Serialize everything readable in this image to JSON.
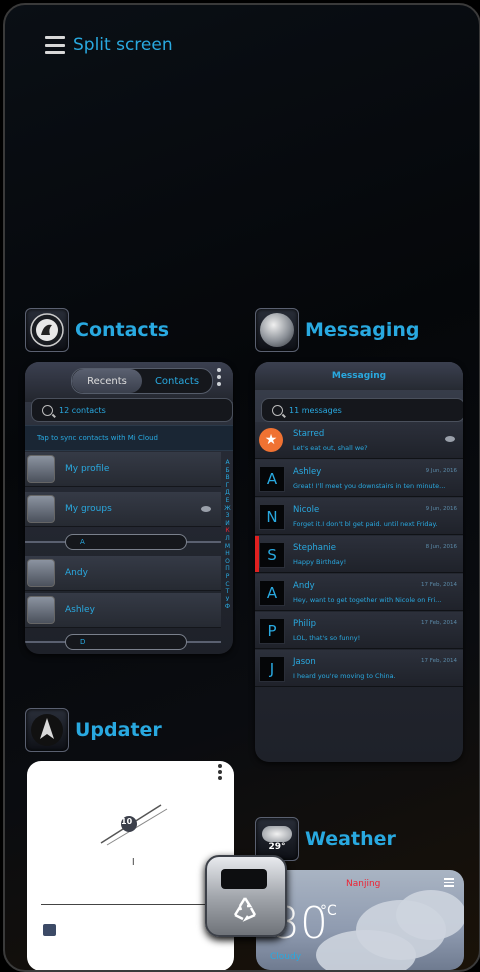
{
  "split_screen": {
    "label": "Split screen"
  },
  "contacts": {
    "title": "Contacts",
    "tab_recents": "Recents",
    "tab_contacts": "Contacts",
    "search_text": "12 contacts",
    "sync_text": "Tap to sync contacts with Mi Cloud",
    "rows": [
      {
        "label": "My profile"
      },
      {
        "label": "My groups"
      }
    ],
    "section_a": "A",
    "contacts": [
      {
        "label": "Andy"
      },
      {
        "label": "Ashley"
      }
    ],
    "section_d": "D",
    "alphabet": [
      "А",
      "Б",
      "В",
      "Г",
      "Д",
      "Е",
      "Ж",
      "З",
      "И",
      "К",
      "Л",
      "М",
      "Н",
      "О",
      "П",
      "Р",
      "С",
      "Т",
      "У",
      "Ф"
    ],
    "alphabet_highlight": "К"
  },
  "messaging": {
    "title": "Messaging",
    "header": "Messaging",
    "search_text": "11 messages",
    "messages": [
      {
        "avatar": "★",
        "name": "Starred",
        "snippet": "Let's eat out, shall we?",
        "date": ""
      },
      {
        "avatar": "A",
        "name": "Ashley",
        "snippet": "Great! I'll meet you downstairs in ten minute...",
        "date": "9 Jun, 2016"
      },
      {
        "avatar": "N",
        "name": "Nicole",
        "snippet": "Forget it.I don't bl get paid. until next Friday.",
        "date": "9 Jun, 2016"
      },
      {
        "avatar": "S",
        "name": "Stephanie",
        "snippet": "Happy Birthday!",
        "date": "8 Jun, 2016"
      },
      {
        "avatar": "A",
        "name": "Andy",
        "snippet": "Hey, want to get together with Nicole on Fri...",
        "date": "17 Feb, 2014"
      },
      {
        "avatar": "P",
        "name": "Philip",
        "snippet": "LOL, that's so funny!",
        "date": "17 Feb, 2014"
      },
      {
        "avatar": "J",
        "name": "Jason",
        "snippet": "I heard you're moving to China.",
        "date": "17 Feb, 2014"
      }
    ]
  },
  "updater": {
    "title": "Updater",
    "logo_text": "10",
    "version_text": "l"
  },
  "weather": {
    "title": "Weather",
    "icon_temp": "29°",
    "city": "Nanjing",
    "temperature": "30",
    "unit": "°C",
    "condition": "Cloudy"
  },
  "colors": {
    "accent": "#29a9e0",
    "star": "#f07232",
    "highlight": "#e02020"
  },
  "icons": {
    "split": "hamburger-icon",
    "more": "kebab-menu-icon",
    "search": "search-icon",
    "recycle": "recycle-bin-icon"
  }
}
